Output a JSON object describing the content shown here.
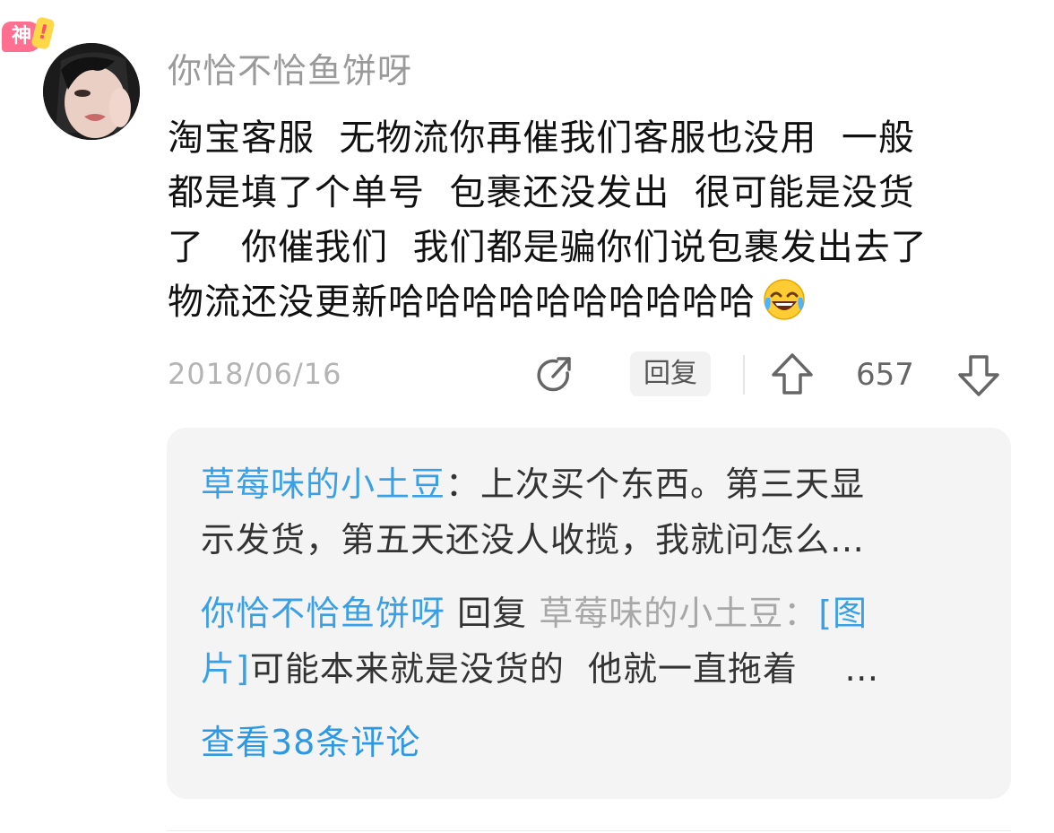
{
  "comment": {
    "badge": "神",
    "badge_mark": "!",
    "username": "你恰不恰鱼饼呀",
    "lines": [
      "淘宝客服  无物流你再催我们客服也没用  一般",
      "都是填了个单号  包裹还没发出  很可能是没货",
      "了   你催我们  我们都是骗你们说包裹发出去了",
      "物流还没更新哈哈哈哈哈哈哈哈哈哈"
    ],
    "emoji": "face-with-tears-of-joy",
    "date": "2018/06/16",
    "reply_label": "回复",
    "vote_count": "657",
    "icons": {
      "share": "share-icon",
      "upvote": "upvote-icon",
      "downvote": "downvote-icon"
    },
    "colors": {
      "link_blue": "#3aa0e6",
      "badge_pink": "#ff6f8f",
      "badge_yellow": "#ffd84a"
    }
  },
  "replies": [
    {
      "author": "草莓味的小土豆",
      "separator": "：",
      "line1": "上次买个东西。第三天显",
      "line2": "示发货，第五天还没人收揽，我就问怎么…"
    },
    {
      "author": "你恰不恰鱼饼呀",
      "verb": " 回复 ",
      "target": "草莓味的小土豆",
      "separator": "：",
      "image_tag_a": "[图",
      "image_tag_b": "片]",
      "line2_text": "可能本来就是没货的  他就一直拖着    …"
    }
  ],
  "view_more": "查看38条评论"
}
